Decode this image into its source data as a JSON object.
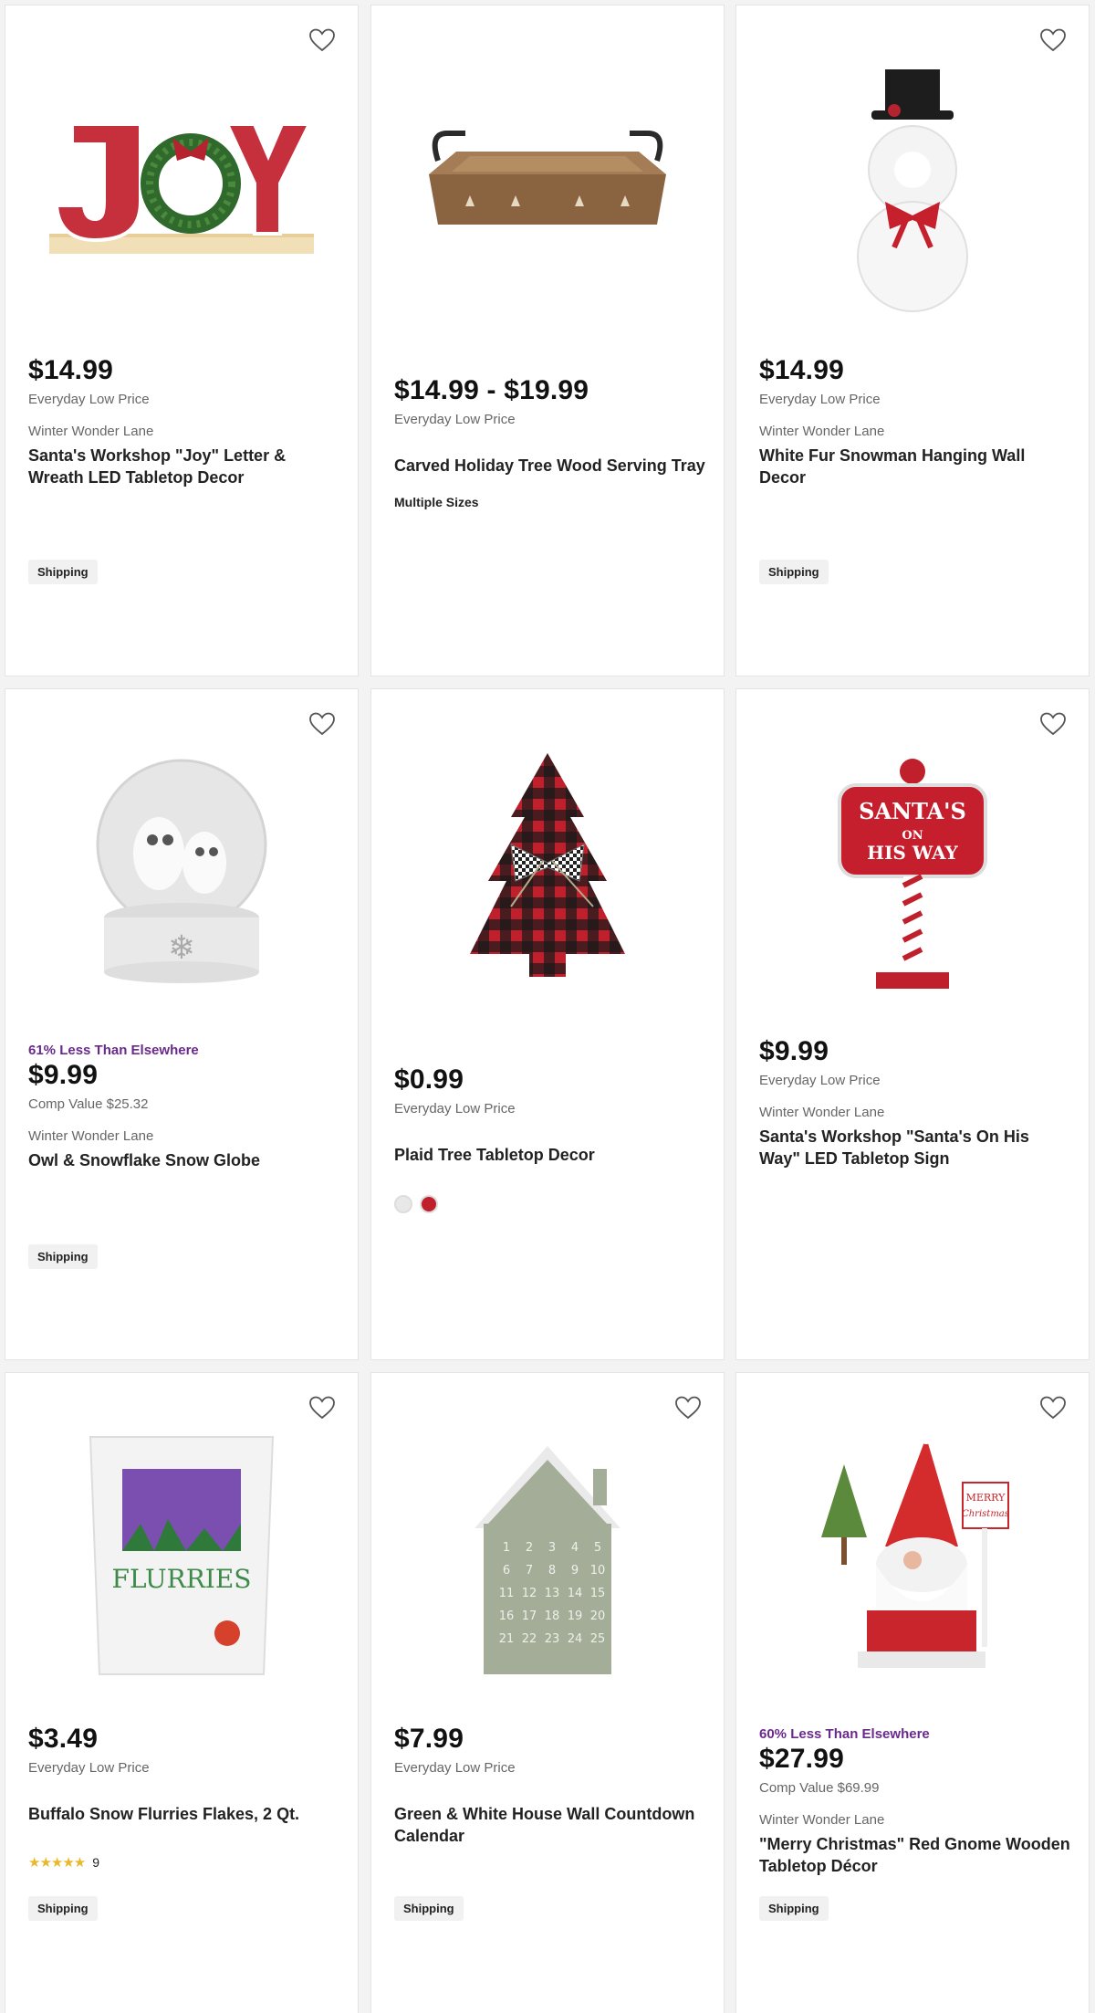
{
  "products": [
    {
      "price": "$14.99",
      "sub": "Everyday Low Price",
      "brand": "Winter Wonder Lane",
      "title": "Santa's Workshop \"Joy\" Letter & Wreath LED Tabletop Decor",
      "badge": "Shipping",
      "image_icon": "joy-sign-image"
    },
    {
      "price": "$14.99 - $19.99",
      "sub": "Everyday Low Price",
      "title": "Carved Holiday Tree Wood Serving Tray",
      "sizes": "Multiple Sizes",
      "image_icon": "wood-tray-image"
    },
    {
      "price": "$14.99",
      "sub": "Everyday Low Price",
      "brand": "Winter Wonder Lane",
      "title": "White Fur Snowman Hanging Wall Decor",
      "badge": "Shipping",
      "image_icon": "snowman-wreath-image"
    },
    {
      "promo": "61% Less Than Elsewhere",
      "price": "$9.99",
      "sub": "Comp Value $25.32",
      "brand": "Winter Wonder Lane",
      "title": "Owl & Snowflake Snow Globe",
      "badge": "Shipping",
      "image_icon": "snow-globe-image"
    },
    {
      "price": "$0.99",
      "sub": "Everyday Low Price",
      "title": "Plaid Tree Tabletop Decor",
      "swatches": [
        "#e8e8e8",
        "#c0202c"
      ],
      "image_icon": "plaid-tree-image"
    },
    {
      "price": "$9.99",
      "sub": "Everyday Low Price",
      "brand": "Winter Wonder Lane",
      "title": "Santa's Workshop \"Santa's On His Way\" LED Tabletop Sign",
      "image_icon": "santa-sign-image",
      "sign_text_1": "SANTA'S",
      "sign_text_2": "ON",
      "sign_text_3": "HIS WAY"
    },
    {
      "price": "$3.49",
      "sub": "Everyday Low Price",
      "title": "Buffalo Snow Flurries Flakes, 2 Qt.",
      "rating_count": "9",
      "rating": 5,
      "badge": "Shipping",
      "image_icon": "snow-bag-image",
      "bag_label": "FLURRIES"
    },
    {
      "price": "$7.99",
      "sub": "Everyday Low Price",
      "title": "Green & White House Wall Countdown Calendar",
      "badge": "Shipping",
      "image_icon": "advent-house-image"
    },
    {
      "promo": "60% Less Than Elsewhere",
      "price": "$27.99",
      "sub": "Comp Value $69.99",
      "brand": "Winter Wonder Lane",
      "title": "\"Merry Christmas\" Red Gnome Wooden Tabletop Décor",
      "badge": "Shipping",
      "image_icon": "gnome-image",
      "gnome_sign_1": "MERRY",
      "gnome_sign_2": "Christmas"
    }
  ],
  "colors": {
    "promo": "#6a2a8c",
    "star": "#e9b82b",
    "heart": "#555555"
  }
}
